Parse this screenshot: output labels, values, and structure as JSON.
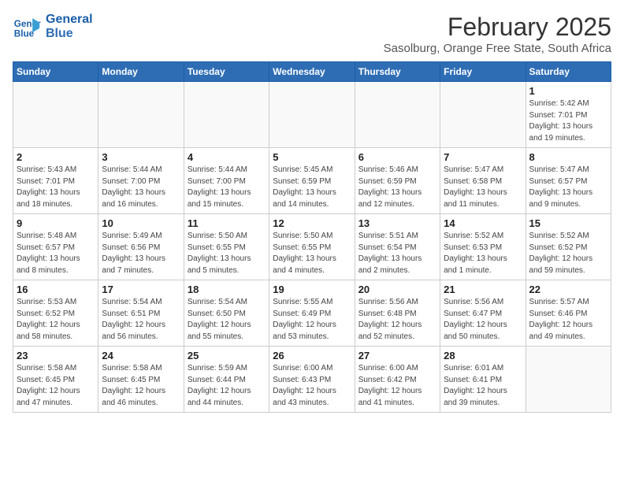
{
  "header": {
    "logo_line1": "General",
    "logo_line2": "Blue",
    "month": "February 2025",
    "location": "Sasolburg, Orange Free State, South Africa"
  },
  "days_of_week": [
    "Sunday",
    "Monday",
    "Tuesday",
    "Wednesday",
    "Thursday",
    "Friday",
    "Saturday"
  ],
  "weeks": [
    [
      {
        "day": "",
        "info": ""
      },
      {
        "day": "",
        "info": ""
      },
      {
        "day": "",
        "info": ""
      },
      {
        "day": "",
        "info": ""
      },
      {
        "day": "",
        "info": ""
      },
      {
        "day": "",
        "info": ""
      },
      {
        "day": "1",
        "info": "Sunrise: 5:42 AM\nSunset: 7:01 PM\nDaylight: 13 hours\nand 19 minutes."
      }
    ],
    [
      {
        "day": "2",
        "info": "Sunrise: 5:43 AM\nSunset: 7:01 PM\nDaylight: 13 hours\nand 18 minutes."
      },
      {
        "day": "3",
        "info": "Sunrise: 5:44 AM\nSunset: 7:00 PM\nDaylight: 13 hours\nand 16 minutes."
      },
      {
        "day": "4",
        "info": "Sunrise: 5:44 AM\nSunset: 7:00 PM\nDaylight: 13 hours\nand 15 minutes."
      },
      {
        "day": "5",
        "info": "Sunrise: 5:45 AM\nSunset: 6:59 PM\nDaylight: 13 hours\nand 14 minutes."
      },
      {
        "day": "6",
        "info": "Sunrise: 5:46 AM\nSunset: 6:59 PM\nDaylight: 13 hours\nand 12 minutes."
      },
      {
        "day": "7",
        "info": "Sunrise: 5:47 AM\nSunset: 6:58 PM\nDaylight: 13 hours\nand 11 minutes."
      },
      {
        "day": "8",
        "info": "Sunrise: 5:47 AM\nSunset: 6:57 PM\nDaylight: 13 hours\nand 9 minutes."
      }
    ],
    [
      {
        "day": "9",
        "info": "Sunrise: 5:48 AM\nSunset: 6:57 PM\nDaylight: 13 hours\nand 8 minutes."
      },
      {
        "day": "10",
        "info": "Sunrise: 5:49 AM\nSunset: 6:56 PM\nDaylight: 13 hours\nand 7 minutes."
      },
      {
        "day": "11",
        "info": "Sunrise: 5:50 AM\nSunset: 6:55 PM\nDaylight: 13 hours\nand 5 minutes."
      },
      {
        "day": "12",
        "info": "Sunrise: 5:50 AM\nSunset: 6:55 PM\nDaylight: 13 hours\nand 4 minutes."
      },
      {
        "day": "13",
        "info": "Sunrise: 5:51 AM\nSunset: 6:54 PM\nDaylight: 13 hours\nand 2 minutes."
      },
      {
        "day": "14",
        "info": "Sunrise: 5:52 AM\nSunset: 6:53 PM\nDaylight: 13 hours\nand 1 minute."
      },
      {
        "day": "15",
        "info": "Sunrise: 5:52 AM\nSunset: 6:52 PM\nDaylight: 12 hours\nand 59 minutes."
      }
    ],
    [
      {
        "day": "16",
        "info": "Sunrise: 5:53 AM\nSunset: 6:52 PM\nDaylight: 12 hours\nand 58 minutes."
      },
      {
        "day": "17",
        "info": "Sunrise: 5:54 AM\nSunset: 6:51 PM\nDaylight: 12 hours\nand 56 minutes."
      },
      {
        "day": "18",
        "info": "Sunrise: 5:54 AM\nSunset: 6:50 PM\nDaylight: 12 hours\nand 55 minutes."
      },
      {
        "day": "19",
        "info": "Sunrise: 5:55 AM\nSunset: 6:49 PM\nDaylight: 12 hours\nand 53 minutes."
      },
      {
        "day": "20",
        "info": "Sunrise: 5:56 AM\nSunset: 6:48 PM\nDaylight: 12 hours\nand 52 minutes."
      },
      {
        "day": "21",
        "info": "Sunrise: 5:56 AM\nSunset: 6:47 PM\nDaylight: 12 hours\nand 50 minutes."
      },
      {
        "day": "22",
        "info": "Sunrise: 5:57 AM\nSunset: 6:46 PM\nDaylight: 12 hours\nand 49 minutes."
      }
    ],
    [
      {
        "day": "23",
        "info": "Sunrise: 5:58 AM\nSunset: 6:45 PM\nDaylight: 12 hours\nand 47 minutes."
      },
      {
        "day": "24",
        "info": "Sunrise: 5:58 AM\nSunset: 6:45 PM\nDaylight: 12 hours\nand 46 minutes."
      },
      {
        "day": "25",
        "info": "Sunrise: 5:59 AM\nSunset: 6:44 PM\nDaylight: 12 hours\nand 44 minutes."
      },
      {
        "day": "26",
        "info": "Sunrise: 6:00 AM\nSunset: 6:43 PM\nDaylight: 12 hours\nand 43 minutes."
      },
      {
        "day": "27",
        "info": "Sunrise: 6:00 AM\nSunset: 6:42 PM\nDaylight: 12 hours\nand 41 minutes."
      },
      {
        "day": "28",
        "info": "Sunrise: 6:01 AM\nSunset: 6:41 PM\nDaylight: 12 hours\nand 39 minutes."
      },
      {
        "day": "",
        "info": ""
      }
    ]
  ]
}
